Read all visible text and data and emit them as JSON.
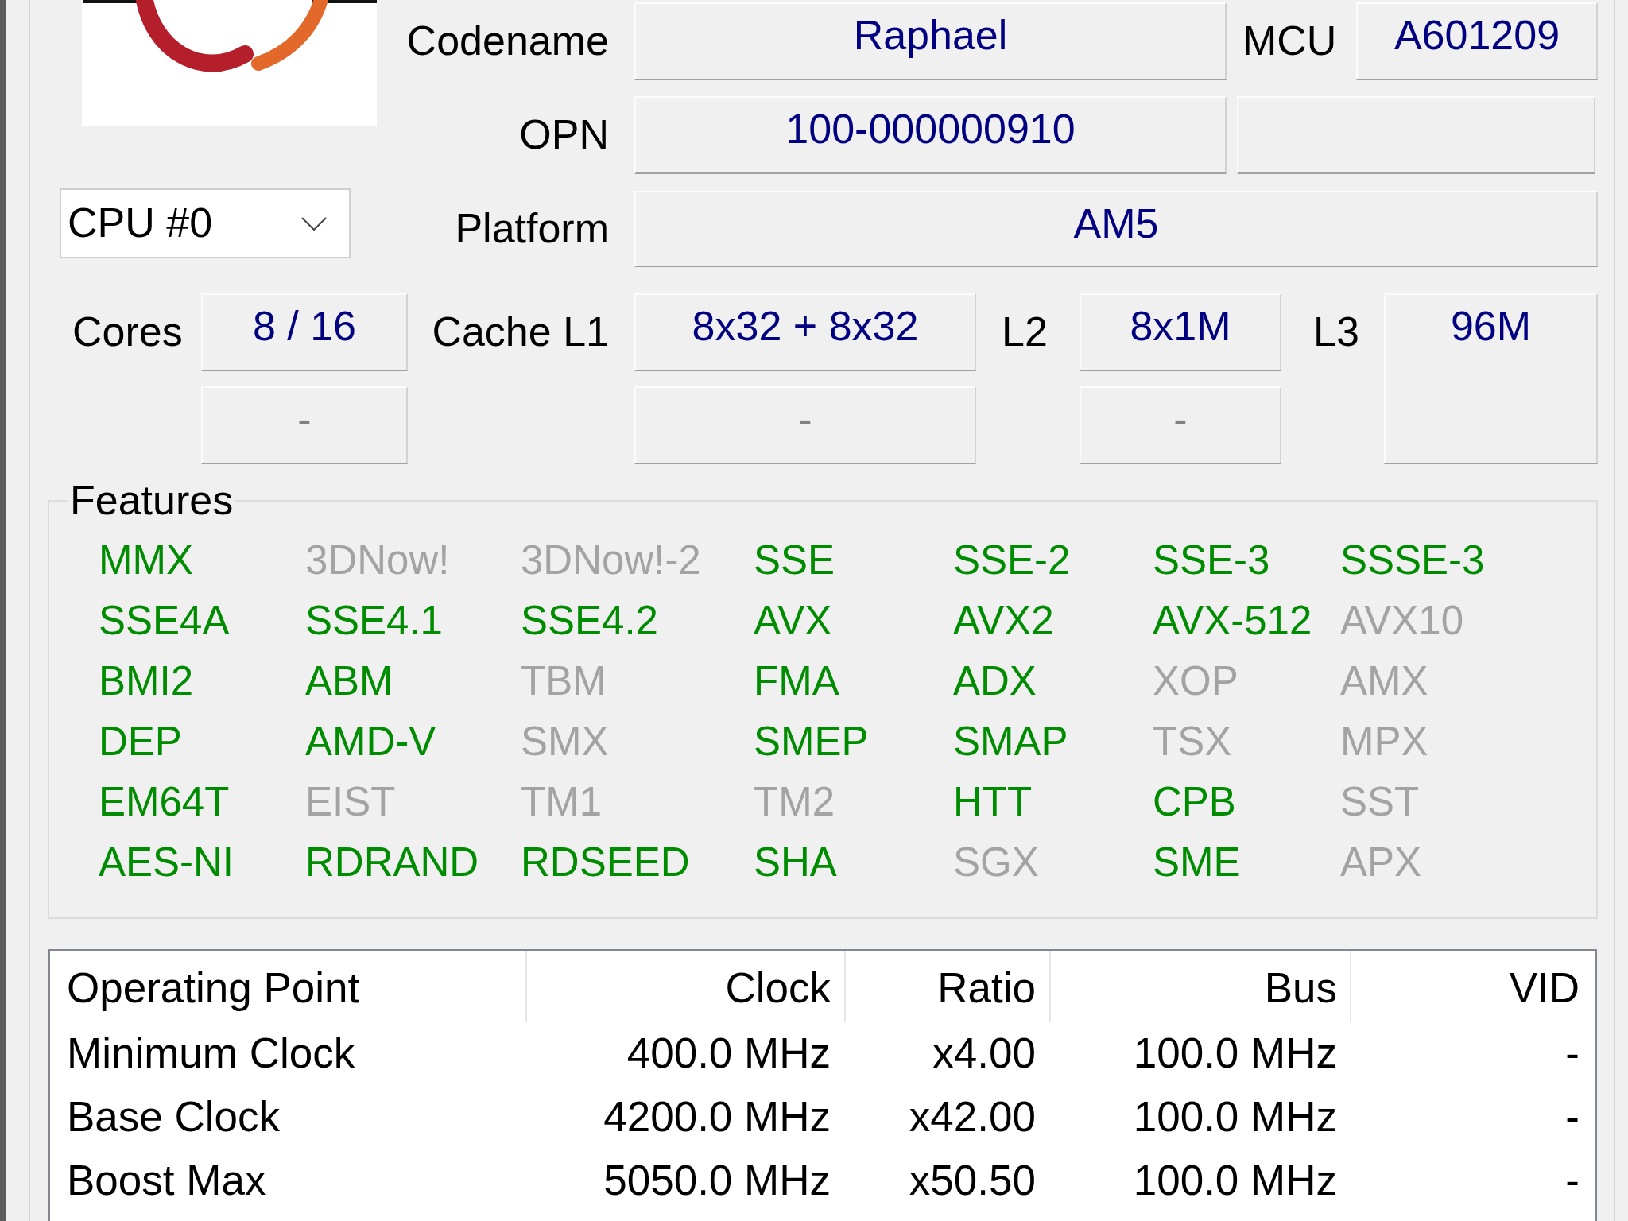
{
  "codename": {
    "label": "Codename",
    "value": "Raphael"
  },
  "mcu": {
    "label": "MCU",
    "value": "A601209"
  },
  "opn": {
    "label": "OPN",
    "value": "100-000000910"
  },
  "cpu_selector": {
    "value": "CPU #0"
  },
  "platform": {
    "label": "Platform",
    "value": "AM5"
  },
  "counts": [
    {
      "label": "Cores",
      "values": [
        {
          "value": "8 / 16",
          "dimmed": false
        },
        {
          "value": "-",
          "dimmed": true
        }
      ]
    },
    {
      "label": "Cache L1",
      "values": [
        {
          "value": "8x32 + 8x32",
          "dimmed": false
        },
        {
          "value": "-",
          "dimmed": true
        }
      ]
    },
    {
      "label": "L2",
      "values": [
        {
          "value": "8x1M",
          "dimmed": false
        },
        {
          "value": "-",
          "dimmed": true
        }
      ]
    },
    {
      "label": "L3",
      "values": [
        {
          "value": "96M",
          "dimmed": false
        }
      ]
    }
  ],
  "features": {
    "title": "Features",
    "items": [
      {
        "name": "MMX",
        "supported": true
      },
      {
        "name": "3DNow!",
        "supported": false
      },
      {
        "name": "3DNow!-2",
        "supported": false
      },
      {
        "name": "SSE",
        "supported": true
      },
      {
        "name": "SSE-2",
        "supported": true
      },
      {
        "name": "SSE-3",
        "supported": true
      },
      {
        "name": "SSSE-3",
        "supported": true
      },
      {
        "name": "SSE4A",
        "supported": true
      },
      {
        "name": "SSE4.1",
        "supported": true
      },
      {
        "name": "SSE4.2",
        "supported": true
      },
      {
        "name": "AVX",
        "supported": true
      },
      {
        "name": "AVX2",
        "supported": true
      },
      {
        "name": "AVX-512",
        "supported": true
      },
      {
        "name": "AVX10",
        "supported": false
      },
      {
        "name": "BMI2",
        "supported": true
      },
      {
        "name": "ABM",
        "supported": true
      },
      {
        "name": "TBM",
        "supported": false
      },
      {
        "name": "FMA",
        "supported": true
      },
      {
        "name": "ADX",
        "supported": true
      },
      {
        "name": "XOP",
        "supported": false
      },
      {
        "name": "AMX",
        "supported": false
      },
      {
        "name": "DEP",
        "supported": true
      },
      {
        "name": "AMD-V",
        "supported": true
      },
      {
        "name": "SMX",
        "supported": false
      },
      {
        "name": "SMEP",
        "supported": true
      },
      {
        "name": "SMAP",
        "supported": true
      },
      {
        "name": "TSX",
        "supported": false
      },
      {
        "name": "MPX",
        "supported": false
      },
      {
        "name": "EM64T",
        "supported": true
      },
      {
        "name": "EIST",
        "supported": false
      },
      {
        "name": "TM1",
        "supported": false
      },
      {
        "name": "TM2",
        "supported": false
      },
      {
        "name": "HTT",
        "supported": true
      },
      {
        "name": "CPB",
        "supported": true
      },
      {
        "name": "SST",
        "supported": false
      },
      {
        "name": "AES-NI",
        "supported": true
      },
      {
        "name": "RDRAND",
        "supported": true
      },
      {
        "name": "RDSEED",
        "supported": true
      },
      {
        "name": "SHA",
        "supported": true
      },
      {
        "name": "SGX",
        "supported": false
      },
      {
        "name": "SME",
        "supported": true
      },
      {
        "name": "APX",
        "supported": false
      }
    ]
  },
  "operating_points": {
    "columns": [
      "Operating Point",
      "Clock",
      "Ratio",
      "Bus",
      "VID"
    ],
    "rows": [
      [
        "Minimum Clock",
        "400.0 MHz",
        "x4.00",
        "100.0 MHz",
        "-"
      ],
      [
        "Base Clock",
        "4200.0 MHz",
        "x42.00",
        "100.0 MHz",
        "-"
      ],
      [
        "Boost Max",
        "5050.0 MHz",
        "x50.50",
        "100.0 MHz",
        "-"
      ]
    ]
  }
}
